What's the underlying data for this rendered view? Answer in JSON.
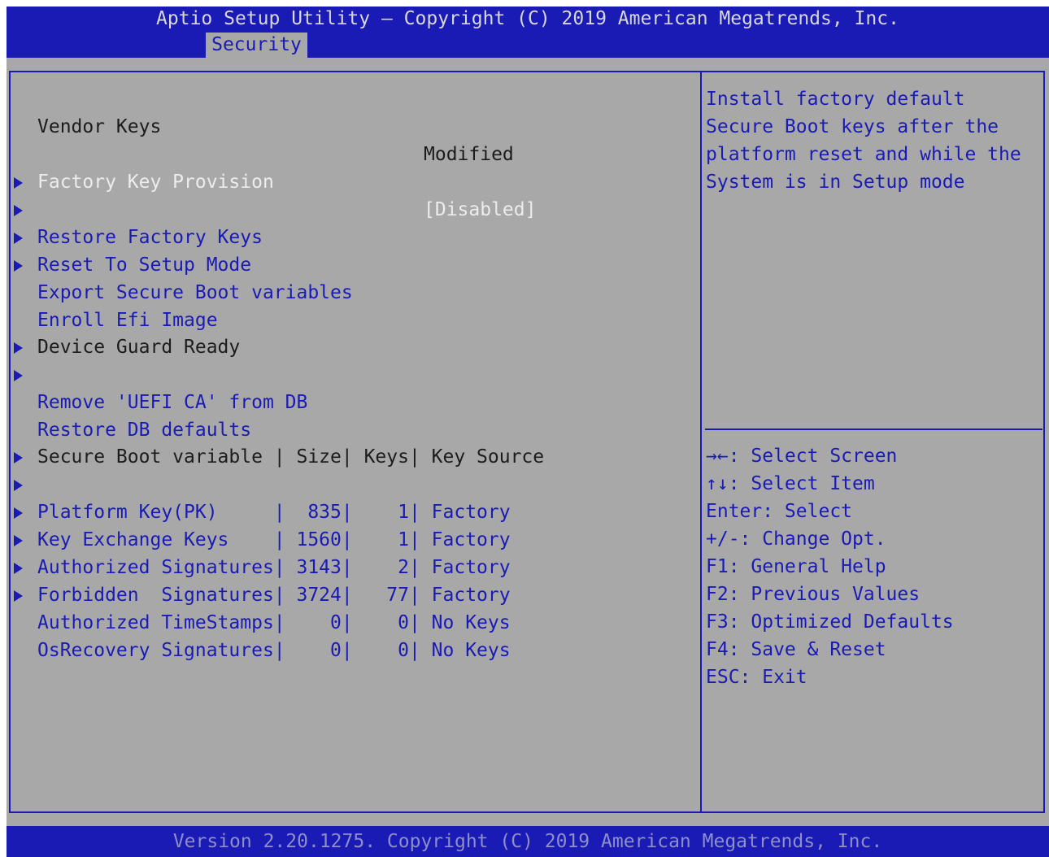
{
  "header": {
    "title": "Aptio Setup Utility – Copyright (C) 2019 American Megatrends, Inc.",
    "tab": "Security"
  },
  "settings": {
    "vendor_keys_label": "Vendor Keys",
    "vendor_keys_value": "Modified",
    "factory_key_provision_label": "Factory Key Provision",
    "factory_key_provision_value": "[Disabled]",
    "menu": [
      "Restore Factory Keys",
      "Reset To Setup Mode",
      "Export Secure Boot variables",
      "Enroll Efi Image"
    ],
    "device_guard_label": "Device Guard Ready",
    "device_guard_menu": [
      "Remove 'UEFI CA' from DB",
      "Restore DB defaults"
    ],
    "table_header": "Secure Boot variable | Size| Keys| Key Source",
    "table_rows": [
      "Platform Key(PK)     |  835|    1| Factory",
      "Key Exchange Keys    | 1560|    1| Factory",
      "Authorized Signatures| 3143|    2| Factory",
      "Forbidden  Signatures| 3724|   77| Factory",
      "Authorized TimeStamps|    0|    0| No Keys",
      "OsRecovery Signatures|    0|    0| No Keys"
    ]
  },
  "help": {
    "text": "Install factory default Secure Boot keys after the platform reset and while the System is in Setup mode"
  },
  "keys": [
    "→←: Select Screen",
    "↑↓: Select Item",
    "Enter: Select",
    "+/-: Change Opt.",
    "F1: General Help",
    "F2: Previous Values",
    "F3: Optimized Defaults",
    "F4: Save & Reset",
    "ESC: Exit"
  ],
  "footer": {
    "version": "Version 2.20.1275. Copyright (C) 2019 American Megatrends, Inc."
  },
  "colors": {
    "background": "#a8a8a8",
    "accent_blue": "#1a1ab5",
    "selected_text": "#ececec"
  }
}
